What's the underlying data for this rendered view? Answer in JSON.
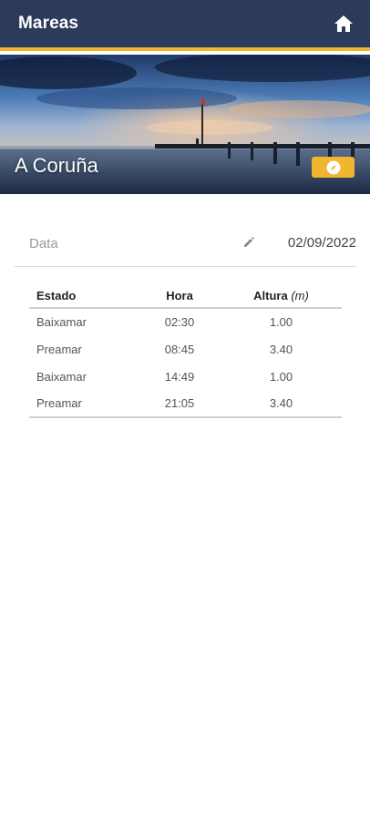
{
  "appbar": {
    "title": "Mareas",
    "home_icon": "home-icon"
  },
  "hero": {
    "location": "A Coruña",
    "action_icon": "compass-icon"
  },
  "date": {
    "label": "Data",
    "value": "02/09/2022",
    "edit_icon": "pencil-icon"
  },
  "table": {
    "headers": {
      "state": "Estado",
      "time": "Hora",
      "height": "Altura",
      "height_unit": "(m)"
    },
    "rows": [
      {
        "state": "Baixamar",
        "time": "02:30",
        "height": "1.00"
      },
      {
        "state": "Preamar",
        "time": "08:45",
        "height": "3.40"
      },
      {
        "state": "Baixamar",
        "time": "14:49",
        "height": "1.00"
      },
      {
        "state": "Preamar",
        "time": "21:05",
        "height": "3.40"
      }
    ]
  },
  "colors": {
    "appbar": "#2c3a5c",
    "accent": "#f2b530"
  }
}
